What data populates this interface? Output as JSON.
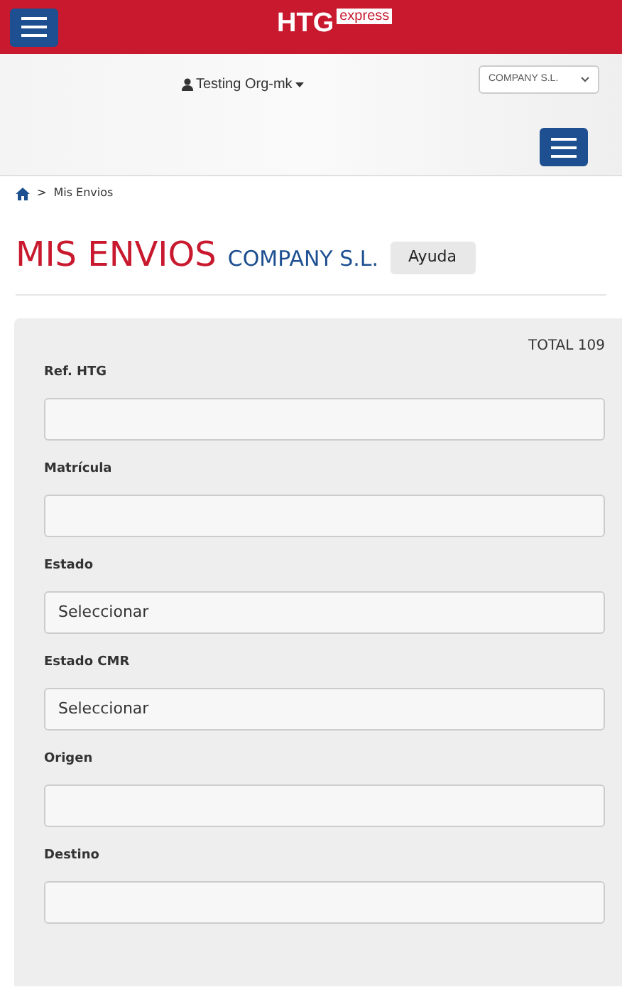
{
  "header": {
    "logo_main": "HTG",
    "logo_sub": "express"
  },
  "user_menu": {
    "label": "Testing Org-mk"
  },
  "company_select": {
    "value": "COMPANY S.L."
  },
  "breadcrumb": {
    "separator": ">",
    "current": "Mis Envios"
  },
  "page_title": {
    "title": "MIS ENVIOS",
    "subtitle": "COMPANY S.L.",
    "help_button": "Ayuda"
  },
  "filters": {
    "total": "TOTAL 109",
    "fields": [
      {
        "label": "Ref. HTG",
        "kind": "text"
      },
      {
        "label": "Matrícula",
        "kind": "text"
      },
      {
        "label": "Estado",
        "kind": "select",
        "value": "Seleccionar"
      },
      {
        "label": "Estado CMR",
        "kind": "select",
        "value": "Seleccionar"
      },
      {
        "label": "Origen",
        "kind": "text"
      },
      {
        "label": "Destino",
        "kind": "text"
      }
    ]
  }
}
